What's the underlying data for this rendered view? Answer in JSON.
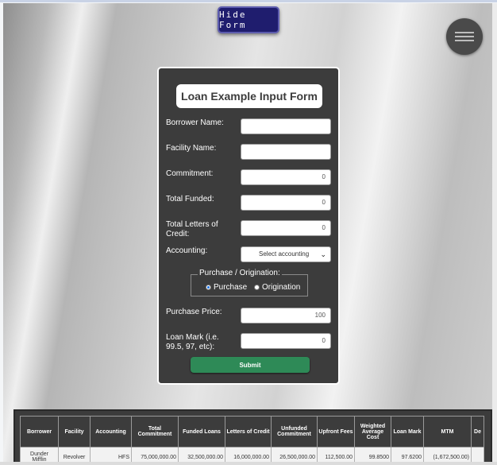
{
  "header": {
    "hide_form_label": "Hide Form"
  },
  "form": {
    "title": "Loan Example Input Form",
    "fields": {
      "borrower_name": {
        "label": "Borrower Name:",
        "value": ""
      },
      "facility_name": {
        "label": "Facility Name:",
        "value": ""
      },
      "commitment": {
        "label": "Commitment:",
        "value": "0"
      },
      "total_funded": {
        "label": "Total Funded:",
        "value": "0"
      },
      "total_letters_of_credit": {
        "label": "Total Letters of Credit:",
        "value": "0"
      },
      "accounting": {
        "label": "Accounting:",
        "selected": "Select accounting"
      },
      "purchase_price": {
        "label": "Purchase Price:",
        "value": "100"
      },
      "loan_mark": {
        "label": "Loan Mark (i.e. 99.5, 97, etc):",
        "value": "0"
      }
    },
    "purchase_origination": {
      "legend": "Purchase / Origination:",
      "options": [
        "Purchase",
        "Origination"
      ],
      "selected": "Purchase"
    },
    "submit_label": "Submit"
  },
  "table": {
    "headers": [
      "Borrower",
      "Facility",
      "Accounting",
      "Total Commitment",
      "Funded Loans",
      "Letters of Credit",
      "Unfunded Commitment",
      "Upfront Fees",
      "Weighted Average Cost",
      "Loan Mark",
      "MTM",
      "De"
    ],
    "rows": [
      [
        "Dunder Mifflin",
        "Revolver",
        "HFS",
        "75,000,000.00",
        "32,500,000.00",
        "16,000,000.00",
        "26,500,000.00",
        "112,500.00",
        "99.8500",
        "97.6200",
        "(1,672,500.00)",
        ""
      ]
    ]
  },
  "colors": {
    "hide_button_bg": "#1f1d6e",
    "form_bg": "#3c3c3c",
    "submit_bg": "#2e8a57",
    "menu_button_bg": "#4a4a4a"
  },
  "icons": {
    "menu": "hamburger-icon",
    "select_arrow": "chevron-down-icon"
  }
}
